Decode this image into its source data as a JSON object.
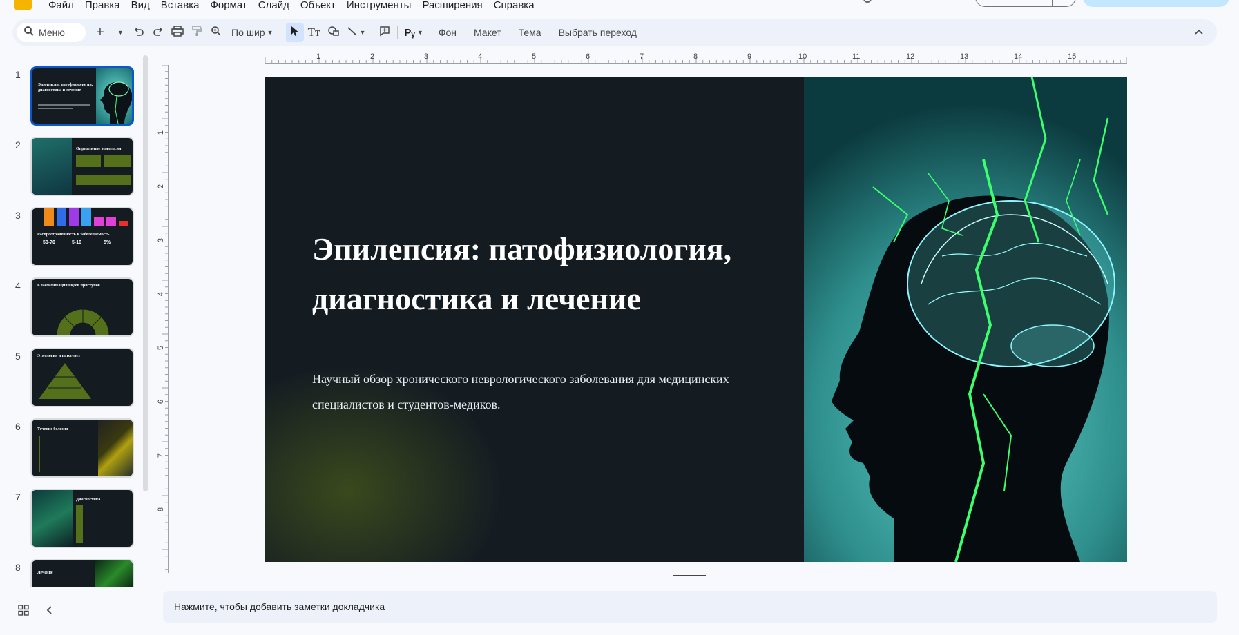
{
  "menubar": {
    "items": [
      "Файл",
      "Правка",
      "Вид",
      "Вставка",
      "Формат",
      "Слайд",
      "Объект",
      "Инструменты",
      "Расширения",
      "Справка"
    ]
  },
  "toolbar": {
    "search_label": "Меню",
    "zoom_label": "По шир",
    "background_label": "Фон",
    "layout_label": "Макет",
    "theme_label": "Тема",
    "transition_label": "Выбрать переход",
    "icons": [
      "search-icon",
      "add-icon",
      "undo-icon",
      "redo-icon",
      "print-icon",
      "paint-format-icon",
      "zoom-icon",
      "select-icon",
      "text-box-icon",
      "shape-icon",
      "line-icon",
      "comment-icon",
      "spell-check-icon",
      "collapse-icon"
    ]
  },
  "filmstrip": {
    "slides": [
      {
        "number": "1",
        "title": "Эпилепсия: патофизиология, диагностика и лечение",
        "selected": true
      },
      {
        "number": "2",
        "title": "Определение эпилепсии",
        "selected": false
      },
      {
        "number": "3",
        "title": "Распространённость и заболеваемость",
        "selected": false
      },
      {
        "number": "4",
        "title": "Классификация видов приступов",
        "selected": false
      },
      {
        "number": "5",
        "title": "Этиология и патогенез",
        "selected": false
      },
      {
        "number": "6",
        "title": "Течение болезни",
        "selected": false
      },
      {
        "number": "7",
        "title": "Диагностика",
        "selected": false
      },
      {
        "number": "8",
        "title": "Лечение",
        "selected": false
      }
    ],
    "thumb3_stats": [
      "50-70",
      "5-10",
      "5%"
    ]
  },
  "ruler": {
    "horizontal": [
      "1",
      "2",
      "3",
      "4",
      "5",
      "6",
      "7",
      "8",
      "9",
      "10",
      "11",
      "12",
      "13",
      "14",
      "15"
    ],
    "vertical": [
      "1",
      "2",
      "3",
      "4",
      "5",
      "6",
      "7",
      "8"
    ]
  },
  "slide": {
    "title": "Эпилепсия: патофизиология, диагностика и лечение",
    "subtitle": "Научный обзор хронического неврологического заболевания для медицинских специалистов и студентов-медиков.",
    "background_color": "#141c22",
    "accent_color": "#5a6e19",
    "image": "glowing-brain-head-silhouette"
  },
  "notes": {
    "placeholder": "Нажмите, чтобы добавить заметки докладчика"
  },
  "bottom_bar": {
    "icons": [
      "grid-view-icon",
      "collapse-panel-icon"
    ]
  },
  "colors": {
    "selection": "#0b57d0",
    "toolbar_bg": "#edf2fa",
    "primary_button": "#c2e7ff"
  }
}
